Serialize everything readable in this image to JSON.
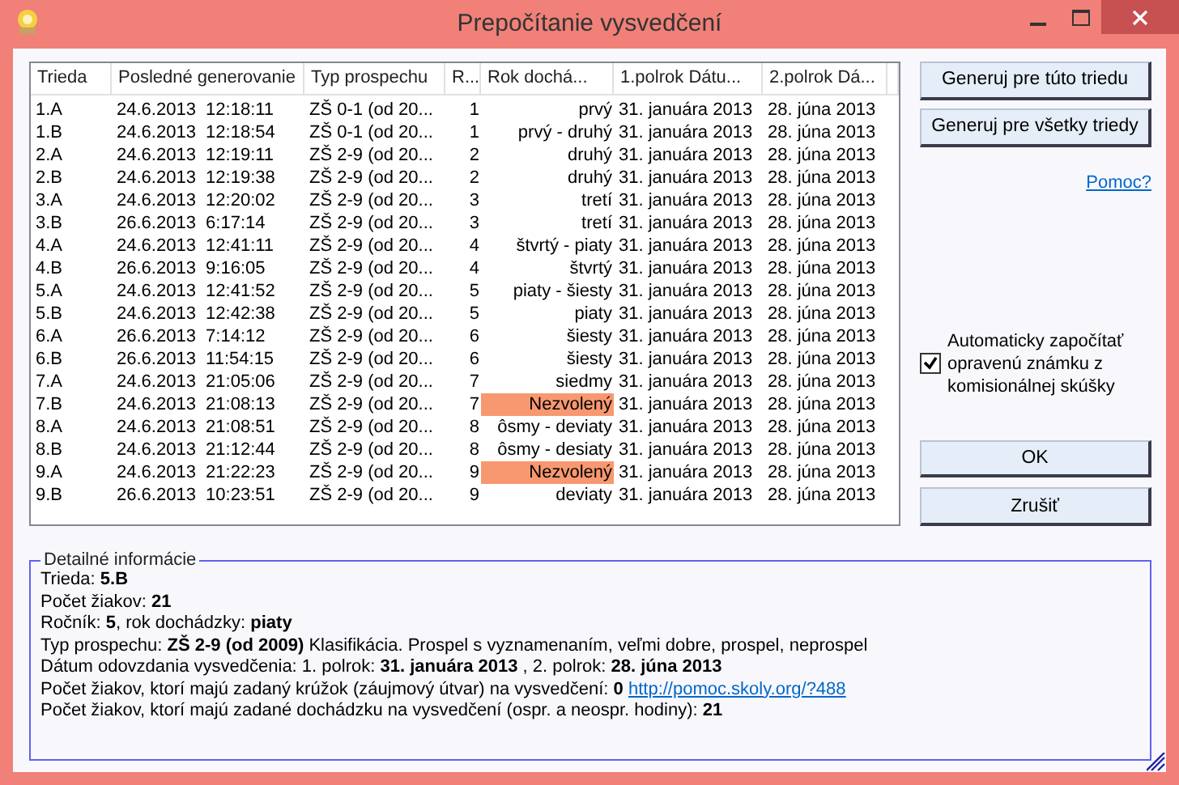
{
  "window": {
    "title": "Prepočítanie vysvedčení"
  },
  "table": {
    "columns": [
      "Trieda",
      "Posledné generovanie",
      "Typ prospechu",
      "R...",
      "Rok dochá...",
      "1.polrok Dátu...",
      "2.polrok Dá..."
    ],
    "rows": [
      {
        "cells": [
          "1.A",
          "24.6.2013  12:18:11",
          "ZŠ 0-1 (od 20...",
          "1",
          "prvý",
          "31. januára 2013",
          "28. júna 2013"
        ],
        "highlighted": false
      },
      {
        "cells": [
          "1.B",
          "24.6.2013  12:18:54",
          "ZŠ 0-1 (od 20...",
          "1",
          "prvý - druhý",
          "31. januára 2013",
          "28. júna 2013"
        ],
        "highlighted": false
      },
      {
        "cells": [
          "2.A",
          "24.6.2013  12:19:11",
          "ZŠ 2-9 (od 20...",
          "2",
          "druhý",
          "31. januára 2013",
          "28. júna 2013"
        ],
        "highlighted": false
      },
      {
        "cells": [
          "2.B",
          "24.6.2013  12:19:38",
          "ZŠ 2-9 (od 20...",
          "2",
          "druhý",
          "31. januára 2013",
          "28. júna 2013"
        ],
        "highlighted": false
      },
      {
        "cells": [
          "3.A",
          "24.6.2013  12:20:02",
          "ZŠ 2-9 (od 20...",
          "3",
          "tretí",
          "31. januára 2013",
          "28. júna 2013"
        ],
        "highlighted": false
      },
      {
        "cells": [
          "3.B",
          "26.6.2013  6:17:14",
          "ZŠ 2-9 (od 20...",
          "3",
          "tretí",
          "31. januára 2013",
          "28. júna 2013"
        ],
        "highlighted": false
      },
      {
        "cells": [
          "4.A",
          "24.6.2013  12:41:11",
          "ZŠ 2-9 (od 20...",
          "4",
          "štvrtý - piaty",
          "31. januára 2013",
          "28. júna 2013"
        ],
        "highlighted": false
      },
      {
        "cells": [
          "4.B",
          "26.6.2013  9:16:05",
          "ZŠ 2-9 (od 20...",
          "4",
          "štvrtý",
          "31. januára 2013",
          "28. júna 2013"
        ],
        "highlighted": false
      },
      {
        "cells": [
          "5.A",
          "24.6.2013  12:41:52",
          "ZŠ 2-9 (od 20...",
          "5",
          "piaty - šiesty",
          "31. januára 2013",
          "28. júna 2013"
        ],
        "highlighted": false
      },
      {
        "cells": [
          "5.B",
          "24.6.2013  12:42:38",
          "ZŠ 2-9 (od 20...",
          "5",
          "piaty",
          "31. januára 2013",
          "28. júna 2013"
        ],
        "highlighted": false
      },
      {
        "cells": [
          "6.A",
          "26.6.2013  7:14:12",
          "ZŠ 2-9 (od 20...",
          "6",
          "šiesty",
          "31. januára 2013",
          "28. júna 2013"
        ],
        "highlighted": false
      },
      {
        "cells": [
          "6.B",
          "26.6.2013  11:54:15",
          "ZŠ 2-9 (od 20...",
          "6",
          "šiesty",
          "31. januára 2013",
          "28. júna 2013"
        ],
        "highlighted": false
      },
      {
        "cells": [
          "7.A",
          "24.6.2013  21:05:06",
          "ZŠ 2-9 (od 20...",
          "7",
          "siedmy",
          "31. januára 2013",
          "28. júna 2013"
        ],
        "highlighted": false
      },
      {
        "cells": [
          "7.B",
          "24.6.2013  21:08:13",
          "ZŠ 2-9 (od 20...",
          "7",
          "Nezvolený",
          "31. januára 2013",
          "28. júna 2013"
        ],
        "highlighted": true
      },
      {
        "cells": [
          "8.A",
          "24.6.2013  21:08:51",
          "ZŠ 2-9 (od 20...",
          "8",
          "ôsmy - deviaty",
          "31. januára 2013",
          "28. júna 2013"
        ],
        "highlighted": false
      },
      {
        "cells": [
          "8.B",
          "24.6.2013  21:12:44",
          "ZŠ 2-9 (od 20...",
          "8",
          "ôsmy - desiaty",
          "31. januára 2013",
          "28. júna 2013"
        ],
        "highlighted": false
      },
      {
        "cells": [
          "9.A",
          "24.6.2013  21:22:23",
          "ZŠ 2-9 (od 20...",
          "9",
          "Nezvolený",
          "31. januára 2013",
          "28. júna 2013"
        ],
        "highlighted": true
      },
      {
        "cells": [
          "9.B",
          "26.6.2013  10:23:51",
          "ZŠ 2-9 (od 20...",
          "9",
          "deviaty",
          "31. januára 2013",
          "28. júna 2013"
        ],
        "highlighted": false
      }
    ]
  },
  "actions": {
    "generate_class": "Generuj pre túto triedu",
    "generate_all": "Generuj pre všetky triedy",
    "help_link": "Pomoc?",
    "auto_checkbox": {
      "label": "Automaticky započítať opravenú známku z komisionálnej skúšky",
      "checked": true
    },
    "ok": "OK",
    "cancel": "Zrušiť"
  },
  "details": {
    "title": "Detailné informácie",
    "lines": [
      {
        "text": "Trieda: **5.B**"
      },
      {
        "text": "Počet žiakov: **21**"
      },
      {
        "text": "Ročník: **5**, rok dochádzky: **piaty**"
      },
      {
        "text": "Typ prospechu: **ZŠ 2-9 (od 2009)** Klasifikácia. Prospel s vyznamenaním, veľmi dobre, prospel, neprospel"
      },
      {
        "text": "Dátum odovzdania vysvedčenia: 1. polrok: **31. januára 2013** , 2. polrok: **28. júna 2013**"
      },
      {
        "text": "Počet žiakov, ktorí majú zadaný krúžok (záujmový útvar) na vysvedčení: **0**",
        "link": "http://pomoc.skoly.org/?488"
      },
      {
        "text": "Počet žiakov, ktorí majú zadané dochádzku na vysvedčení (ospr. a neospr. hodiny): **21**"
      }
    ]
  }
}
